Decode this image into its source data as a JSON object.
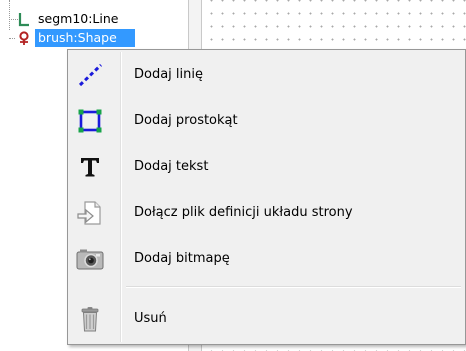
{
  "tree": {
    "items": [
      {
        "label": "segm10:Line",
        "icon": "line-icon"
      },
      {
        "label": "brush:Shape",
        "icon": "shape-icon",
        "selected": true
      }
    ]
  },
  "context_menu": {
    "items": [
      {
        "label": "Dodaj linię",
        "icon": "dashed-line-icon"
      },
      {
        "label": "Dodaj prostokąt",
        "icon": "rectangle-icon"
      },
      {
        "label": "Dodaj tekst",
        "icon": "text-icon"
      },
      {
        "label": "Dołącz plik definicji układu strony",
        "icon": "attach-file-icon"
      },
      {
        "label": "Dodaj bitmapę",
        "icon": "camera-icon"
      },
      {
        "label": "Usuń",
        "icon": "trash-icon"
      }
    ]
  },
  "colors": {
    "selection": "#3399ff",
    "line_icon": "#2e8b57",
    "shape_icon": "#b22222",
    "menu_accent": "#1a1adb"
  }
}
